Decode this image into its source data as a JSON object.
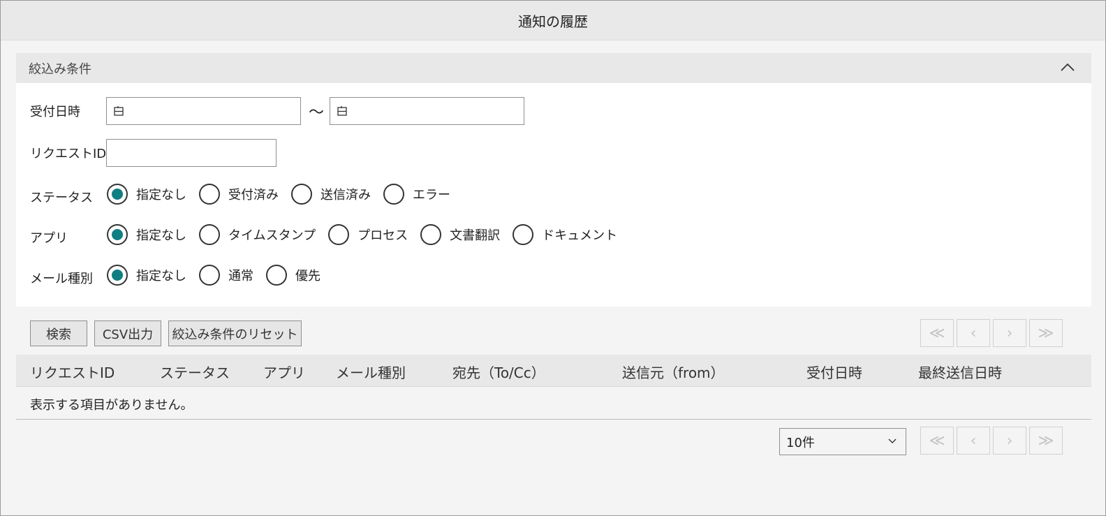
{
  "window": {
    "title": "通知の履歴"
  },
  "filter": {
    "header": "絞込み条件",
    "received_label": "受付日時",
    "date_from": {
      "value": ""
    },
    "date_to": {
      "value": ""
    },
    "range_separator": "～",
    "request_id_label": "リクエストID",
    "request_id_value": "",
    "status_label": "ステータス",
    "status_options": [
      {
        "label": "指定なし",
        "checked": true
      },
      {
        "label": "受付済み",
        "checked": false
      },
      {
        "label": "送信済み",
        "checked": false
      },
      {
        "label": "エラー",
        "checked": false
      }
    ],
    "app_label": "アプリ",
    "app_options": [
      {
        "label": "指定なし",
        "checked": true
      },
      {
        "label": "タイムスタンプ",
        "checked": false
      },
      {
        "label": "プロセス",
        "checked": false
      },
      {
        "label": "文書翻訳",
        "checked": false
      },
      {
        "label": "ドキュメント",
        "checked": false
      }
    ],
    "mail_type_label": "メール種別",
    "mail_type_options": [
      {
        "label": "指定なし",
        "checked": true
      },
      {
        "label": "通常",
        "checked": false
      },
      {
        "label": "優先",
        "checked": false
      }
    ]
  },
  "toolbar": {
    "search": "検索",
    "csv": "CSV出力",
    "reset": "絞込み条件のリセット"
  },
  "table": {
    "columns": [
      "リクエストID",
      "ステータス",
      "アプリ",
      "メール種別",
      "宛先（To/Cc）",
      "送信元（from）",
      "受付日時",
      "最終送信日時"
    ],
    "empty_message": "表示する項目がありません。"
  },
  "pagination": {
    "page_size": "10件",
    "first": "≪",
    "prev": "‹",
    "next": "›",
    "last": "≫"
  },
  "colors": {
    "accent": "#0f7f82"
  }
}
